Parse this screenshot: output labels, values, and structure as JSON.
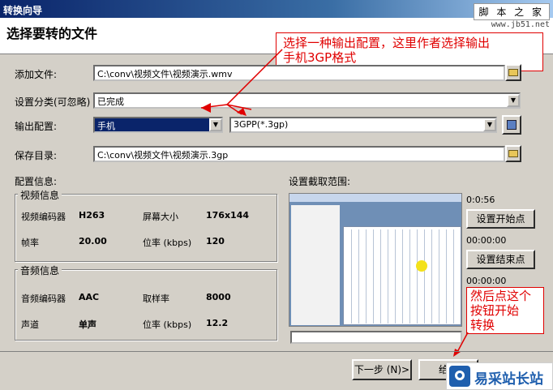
{
  "window": {
    "title": "转换向导"
  },
  "header": {
    "title": "选择要转的文件",
    "stamp": "脚 本 之 家",
    "site": "www.jb51.net"
  },
  "form": {
    "add_file_label": "添加文件:",
    "add_file_value": "C:\\conv\\视频文件\\视频演示.wmv",
    "category_label": "设置分类(可忽略)",
    "category_value": "已完成",
    "output_label": "输出配置:",
    "device_value": "手机",
    "format_value": "3GPP(*.3gp)",
    "save_dir_label": "保存目录:",
    "save_dir_value": "C:\\conv\\视频文件\\视频演示.3gp"
  },
  "config": {
    "label": "配置信息:",
    "video_group": "视频信息",
    "video_encoder_label": "视频编码器",
    "video_encoder_value": "H263",
    "screen_size_label": "屏幕大小",
    "screen_size_value": "176x144",
    "fps_label": "帧率",
    "fps_value": "20.00",
    "video_bitrate_label": "位率 (kbps)",
    "video_bitrate_value": "120",
    "audio_group": "音频信息",
    "audio_encoder_label": "音频编码器",
    "audio_encoder_value": "AAC",
    "sample_rate_label": "取样率",
    "sample_rate_value": "8000",
    "channel_label": "声道",
    "channel_value": "单声",
    "audio_bitrate_label": "位率 (kbps)",
    "audio_bitrate_value": "12.2"
  },
  "range": {
    "label": "设置截取范围:",
    "start_time": "0:0:56",
    "set_start_label": "设置开始点",
    "end_time": "00:00:00",
    "end_time2": "00:00:00",
    "set_end_label": "设置结束点"
  },
  "annotations": {
    "note1_line1": "选择一种输出配置，这里作者选择输出",
    "note1_line2": "手机3GP格式",
    "note2_line1": "然后点这个",
    "note2_line2": "按钮开始",
    "note2_line3": "转换"
  },
  "footer": {
    "next_label": "下一步 (N)>",
    "start_label": "给我",
    "watermark": "易采站长站"
  },
  "colors": {
    "accent": "#e00000",
    "title_bar": "#0a246a",
    "selection": "#0a246a"
  }
}
